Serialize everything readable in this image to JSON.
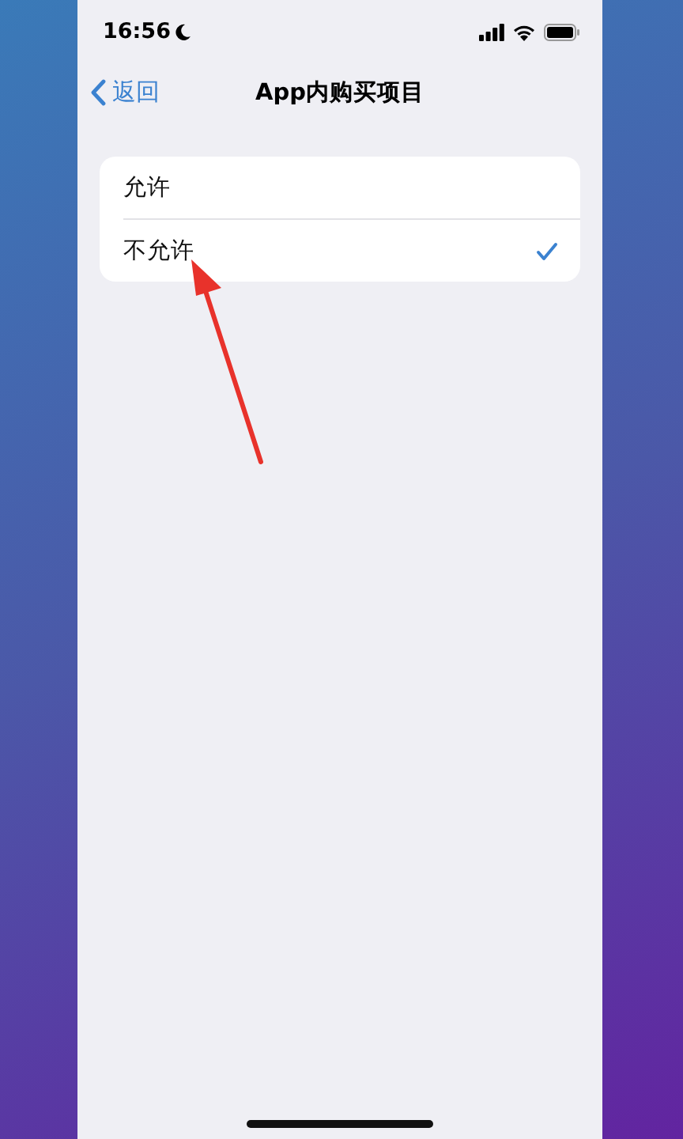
{
  "status_bar": {
    "time": "16:56",
    "focus_moon": true
  },
  "nav": {
    "back": "返回",
    "title": "App内购买项目"
  },
  "options": [
    {
      "label": "允许",
      "selected": false
    },
    {
      "label": "不允许",
      "selected": true
    }
  ],
  "annotation": {
    "kind": "arrow"
  }
}
